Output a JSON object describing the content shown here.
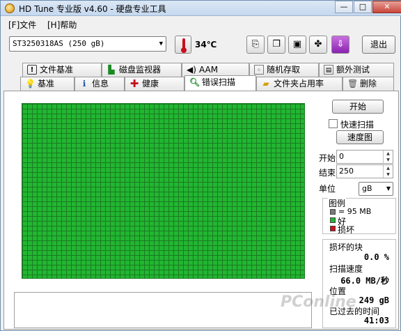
{
  "window": {
    "title": "HD Tune 专业版 v4.60 - 硬盘专业工具",
    "controls": [
      "—",
      "□",
      "✕"
    ]
  },
  "menu": [
    "[F]文件",
    "[H]帮助"
  ],
  "toolbar": {
    "drive": "ST3250318AS (250 gB)",
    "temperature": "34℃",
    "exit_label": "退出",
    "icons": [
      "copy-text-icon",
      "copy-screenshot-icon",
      "save-icon",
      "options-icon",
      "download-icon"
    ]
  },
  "tabs_top": [
    {
      "label": "文件基准",
      "icon": "info-icon"
    },
    {
      "label": "磁盘监视器",
      "icon": "monitor-icon"
    },
    {
      "label": "AAM",
      "icon": "speaker-icon"
    },
    {
      "label": "随机存取",
      "icon": "random-icon"
    },
    {
      "label": "额外测试",
      "icon": "extra-test-icon"
    }
  ],
  "tabs_bottom": [
    {
      "label": "基准",
      "icon": "benchmark-icon"
    },
    {
      "label": "信息",
      "icon": "info-icon"
    },
    {
      "label": "健康",
      "icon": "health-icon"
    },
    {
      "label": "错误扫描",
      "icon": "magnifier-icon",
      "active": true
    },
    {
      "label": "文件夹占用率",
      "icon": "folder-icon"
    },
    {
      "label": "删除",
      "icon": "trash-icon"
    }
  ],
  "scan": {
    "start_button": "开始",
    "quick_scan_label": "快速扫描",
    "quick_scan_checked": false,
    "speed_map_button": "速度图",
    "start_label": "开始",
    "start_value": "0",
    "end_label": "结束",
    "end_value": "250",
    "unit_label": "单位",
    "unit_value": "gB",
    "legend_title": "图例",
    "legend_block": "= 95 MB",
    "legend_good": "好",
    "legend_bad": "损坏",
    "colors": {
      "block": "#7a7a7a",
      "good": "#22b631",
      "bad": "#c8101e"
    },
    "bad_blocks_label": "损坏的块",
    "bad_blocks_value": "0.0 %",
    "scan_speed_label": "扫描速度",
    "scan_speed_value": "66.0 MB/秒",
    "position_label": "位置",
    "position_value": "249 gB",
    "elapsed_label": "已过去的时间",
    "elapsed_value": "41:03"
  },
  "watermark": "PConline"
}
